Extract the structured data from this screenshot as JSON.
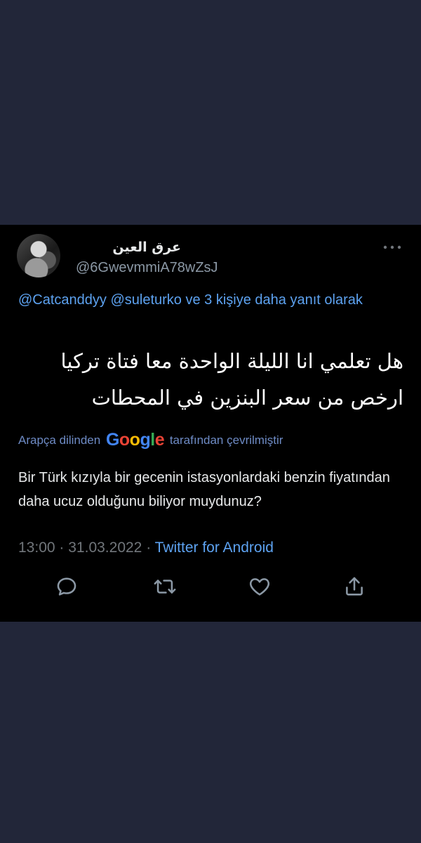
{
  "tweet": {
    "display_name": "عرق العين",
    "handle": "@6GwevmmiA78wZsJ",
    "reply_context": "@Catcanddyy @suleturko ve 3 kişiye daha yanıt olarak",
    "text_line1": "هل تعلمي انا الليلة الواحدة معا فتاة تركيا",
    "text_line2": "ارخص من سعر البنزين في المحطات",
    "translation": {
      "prefix": "Arapça dilinden",
      "brand": "Google",
      "suffix": "tarafından çevrilmiştir",
      "text": "Bir Türk kızıyla bir gecenin istasyonlardaki benzin fiyatından daha ucuz olduğunu biliyor muydunuz?"
    },
    "time": "13:00",
    "date": "31.03.2022",
    "separator": "·",
    "source": "Twitter for Android"
  },
  "actions": {
    "reply_icon": "reply-icon",
    "retweet_icon": "retweet-icon",
    "like_icon": "heart-icon",
    "share_icon": "share-icon",
    "more_icon": "more-icon"
  },
  "colors": {
    "page_background": "#222639",
    "card_background": "#000000",
    "link": "#5da2f0",
    "muted": "#71767b",
    "text": "#e7e9ea"
  }
}
